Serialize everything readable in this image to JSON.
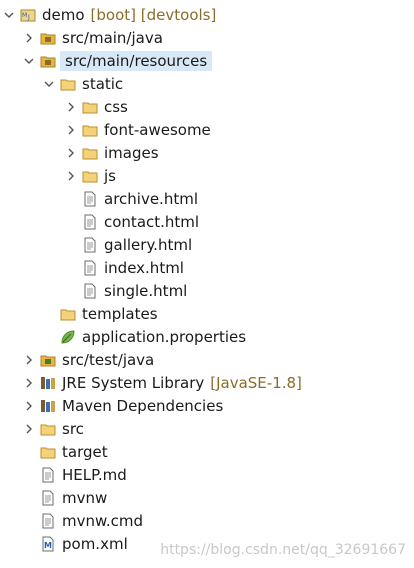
{
  "tree": {
    "project": {
      "label": "demo",
      "decor": "[boot] [devtools]"
    },
    "src_main_java": {
      "label": "src/main/java"
    },
    "src_main_resources": {
      "label": "src/main/resources"
    },
    "static": {
      "label": "static"
    },
    "css": {
      "label": "css"
    },
    "font_awesome": {
      "label": "font-awesome"
    },
    "images": {
      "label": "images"
    },
    "js": {
      "label": "js"
    },
    "archive": {
      "label": "archive.html"
    },
    "contact": {
      "label": "contact.html"
    },
    "gallery": {
      "label": "gallery.html"
    },
    "index": {
      "label": "index.html"
    },
    "single": {
      "label": "single.html"
    },
    "templates": {
      "label": "templates"
    },
    "application_properties": {
      "label": "application.properties"
    },
    "src_test_java": {
      "label": "src/test/java"
    },
    "jre": {
      "label": "JRE System Library",
      "decor": "[JavaSE-1.8]"
    },
    "maven": {
      "label": "Maven Dependencies"
    },
    "src": {
      "label": "src"
    },
    "target": {
      "label": "target"
    },
    "help": {
      "label": "HELP.md"
    },
    "mvnw": {
      "label": "mvnw"
    },
    "mvnw_cmd": {
      "label": "mvnw.cmd"
    },
    "pom": {
      "label": "pom.xml"
    }
  },
  "watermark": "https://blog.csdn.net/qq_32691667",
  "colors": {
    "selection": "#d9e8f7",
    "decor": "#8a6d2b",
    "folder": "#e8b640",
    "package": "#b08a3a"
  }
}
